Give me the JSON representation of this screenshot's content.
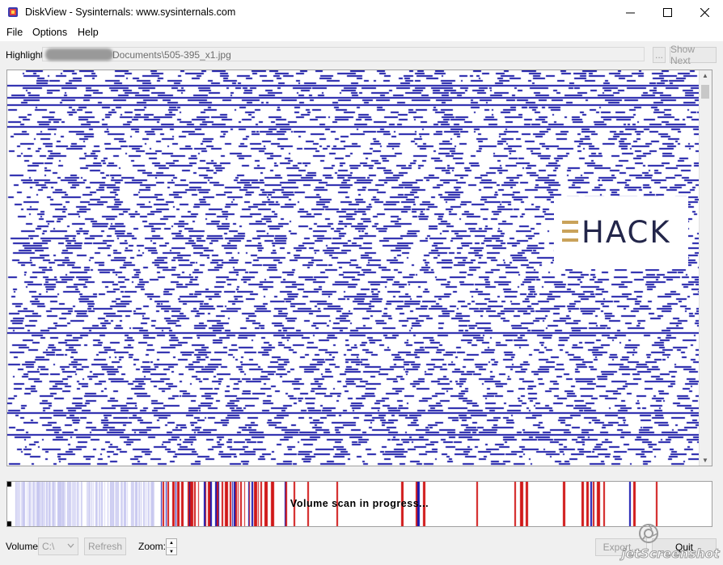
{
  "window": {
    "title": "DiskView - Sysinternals: www.sysinternals.com",
    "controls": [
      "minimize-icon",
      "maximize-icon",
      "close-icon"
    ]
  },
  "menu": {
    "items": [
      {
        "label": "File"
      },
      {
        "label": "Options"
      },
      {
        "label": "Help"
      }
    ]
  },
  "highlight": {
    "label": "Highlight:",
    "path": "Documents\\505-395_x1.jpg",
    "browse_label": "...",
    "show_next_label": "Show Next"
  },
  "map": {
    "cluster_color": "#1a1aa8",
    "background_color": "#ffffff"
  },
  "logo": {
    "text": "HACK",
    "bar_color": "#c9a25a",
    "text_color": "#23264a"
  },
  "scan": {
    "status_text": "Volume scan in progress...",
    "colors": {
      "used": "#d01818",
      "highlight": "#1818b0",
      "light": "#c8c8f0"
    }
  },
  "bottom": {
    "volume_label": "Volume:",
    "volume_value": "C:\\",
    "refresh_label": "Refresh",
    "zoom_label": "Zoom:",
    "export_label": "Export...",
    "quit_label": "Quit"
  },
  "watermark": {
    "text": "jetScreenshot"
  }
}
